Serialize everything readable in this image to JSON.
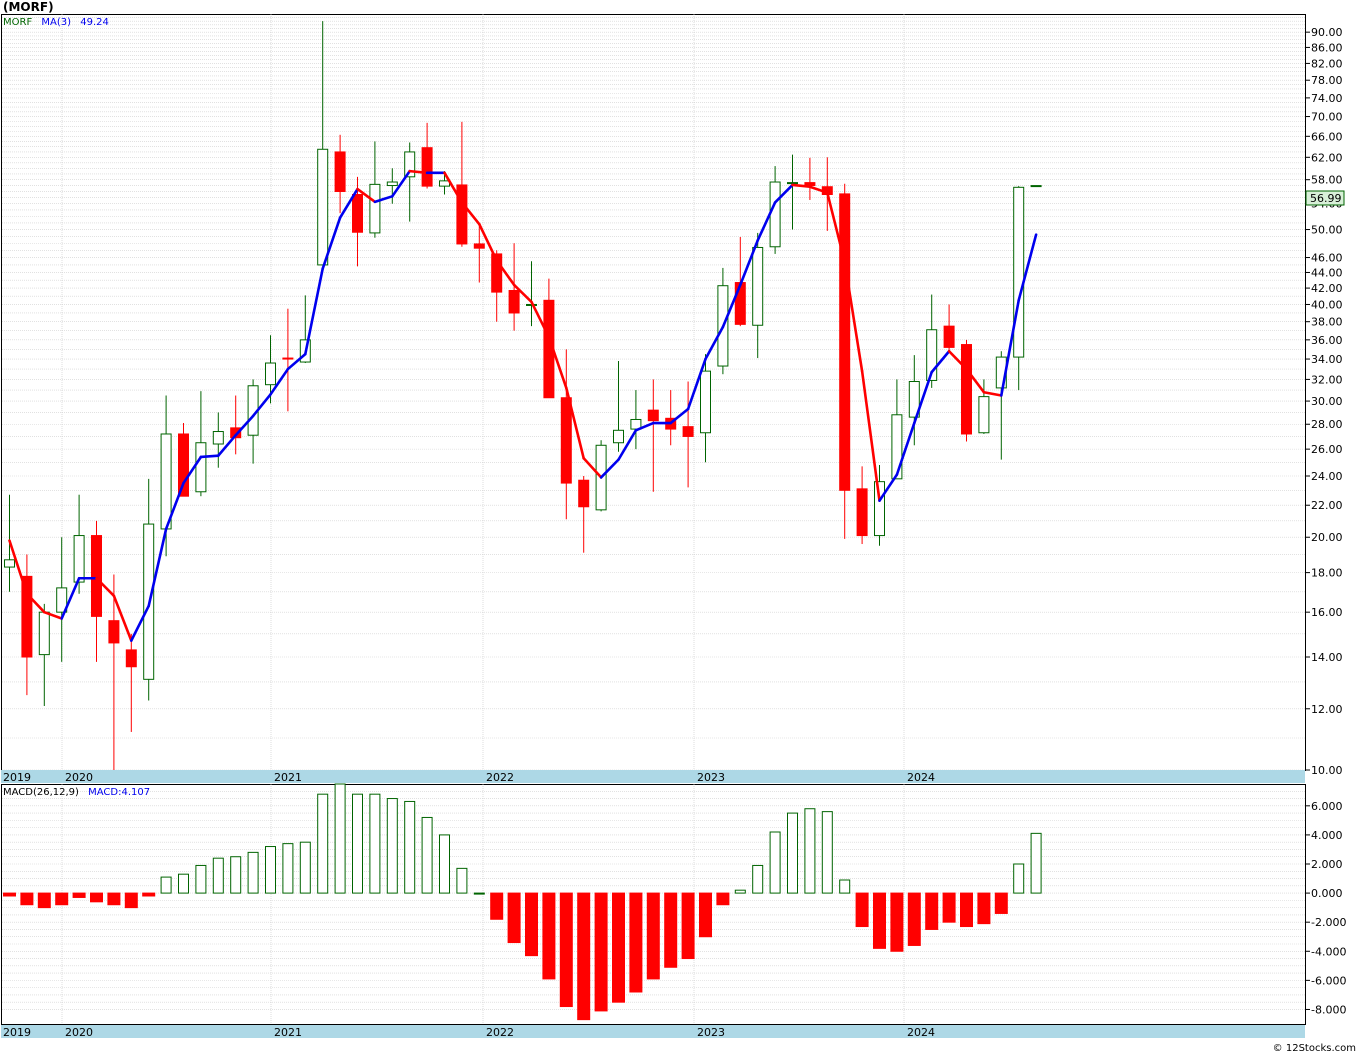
{
  "title": "(MORF)",
  "watermark": "© 12Stocks.com",
  "colors": {
    "up": "#006400",
    "down": "#ff0000",
    "ma_up": "#0000ee",
    "ma_down": "#ff0000",
    "axisband": "#add8e6",
    "price_box": "#d8f0d8"
  },
  "legend_price": {
    "symbol": "MORF",
    "ma_label": "MA(3)",
    "ma_value": "49.24"
  },
  "legend_macd": {
    "label": "MACD(26,12,9)",
    "value_label": "MACD:4.107"
  },
  "current_price_label": "56.99",
  "years": [
    "2019",
    "2020",
    "2021",
    "2022",
    "2023",
    "2024"
  ],
  "chart_data": [
    {
      "type": "candlestick",
      "title": "(MORF)",
      "yscale": "log",
      "ylim": [
        10,
        95
      ],
      "grid": true,
      "yticks": [
        "10.00",
        "12.00",
        "14.00",
        "16.00",
        "18.00",
        "20.00",
        "22.00",
        "24.00",
        "26.00",
        "28.00",
        "30.00",
        "32.00",
        "34.00",
        "36.00",
        "38.00",
        "40.00",
        "42.00",
        "44.00",
        "46.00",
        "50.00",
        "54.00",
        "58.00",
        "62.00",
        "66.00",
        "70.00",
        "74.00",
        "78.00",
        "82.00",
        "86.00",
        "90.00"
      ],
      "x": [
        "2019-07",
        "2019-08",
        "2019-09",
        "2019-10",
        "2019-11",
        "2019-12",
        "2020-01",
        "2020-02",
        "2020-03",
        "2020-04",
        "2020-05",
        "2020-06",
        "2020-07",
        "2020-08",
        "2020-09",
        "2020-10",
        "2020-11",
        "2020-12",
        "2021-01",
        "2021-02",
        "2021-03",
        "2021-04",
        "2021-05",
        "2021-06",
        "2021-07",
        "2021-08",
        "2021-09",
        "2021-10",
        "2021-11",
        "2021-12",
        "2022-01",
        "2022-02",
        "2022-03",
        "2022-04",
        "2022-05",
        "2022-06",
        "2022-07",
        "2022-08",
        "2022-09",
        "2022-10",
        "2022-11",
        "2022-12",
        "2023-01",
        "2023-02",
        "2023-03",
        "2023-04",
        "2023-05",
        "2023-06",
        "2023-07",
        "2023-08",
        "2023-09",
        "2023-10",
        "2023-11",
        "2023-12",
        "2024-01",
        "2024-02",
        "2024-03",
        "2024-04",
        "2024-05",
        "2024-06",
        "2024-07",
        "2024-08"
      ],
      "ohlc": [
        [
          18.3,
          22.7,
          17.0,
          18.7
        ],
        [
          17.8,
          19.0,
          12.5,
          14.0
        ],
        [
          14.1,
          16.4,
          12.1,
          16.0
        ],
        [
          16.0,
          20.0,
          13.8,
          17.2
        ],
        [
          17.5,
          22.7,
          16.9,
          20.1
        ],
        [
          20.1,
          21.0,
          13.8,
          15.8
        ],
        [
          15.6,
          17.9,
          9.9,
          14.6
        ],
        [
          14.3,
          15.0,
          11.2,
          13.6
        ],
        [
          13.1,
          23.8,
          12.3,
          20.8
        ],
        [
          20.5,
          30.5,
          18.9,
          27.2
        ],
        [
          27.2,
          28.1,
          22.6,
          22.6
        ],
        [
          22.9,
          30.9,
          22.6,
          26.5
        ],
        [
          26.4,
          29.0,
          24.6,
          27.4
        ],
        [
          27.7,
          30.5,
          25.6,
          26.9
        ],
        [
          27.1,
          32.0,
          24.9,
          31.4
        ],
        [
          31.5,
          36.5,
          29.8,
          33.6
        ],
        [
          34.1,
          39.5,
          29.1,
          34.0
        ],
        [
          33.7,
          41.1,
          33.6,
          36.0
        ],
        [
          45.0,
          93.0,
          45.0,
          63.5
        ],
        [
          63.0,
          66.3,
          52.5,
          56.0
        ],
        [
          55.5,
          58.5,
          44.8,
          49.6
        ],
        [
          49.5,
          65.0,
          48.8,
          57.2
        ],
        [
          57.0,
          60.0,
          54.0,
          57.6
        ],
        [
          58.5,
          64.8,
          51.2,
          63.0
        ],
        [
          63.8,
          68.7,
          56.5,
          56.9
        ],
        [
          56.9,
          59.5,
          55.5,
          57.8
        ],
        [
          57.1,
          68.9,
          47.5,
          47.9
        ],
        [
          47.9,
          50.5,
          42.7,
          47.3
        ],
        [
          46.5,
          47.0,
          38.0,
          41.5
        ],
        [
          41.7,
          48.0,
          37.0,
          39.0
        ],
        [
          40.0,
          45.5,
          37.5,
          40.0
        ],
        [
          40.5,
          43.2,
          30.3,
          30.3
        ],
        [
          30.3,
          35.0,
          21.1,
          23.5
        ],
        [
          23.7,
          24.0,
          19.1,
          21.9
        ],
        [
          21.7,
          26.7,
          21.6,
          26.3
        ],
        [
          26.5,
          33.8,
          25.8,
          27.5
        ],
        [
          27.6,
          31.0,
          26.0,
          28.4
        ],
        [
          29.2,
          32.0,
          22.9,
          28.3
        ],
        [
          28.5,
          31.0,
          26.3,
          27.6
        ],
        [
          27.8,
          31.8,
          23.2,
          27.0
        ],
        [
          27.3,
          34.5,
          25.0,
          32.8
        ],
        [
          33.3,
          44.6,
          32.5,
          42.3
        ],
        [
          42.7,
          48.9,
          37.5,
          37.7
        ],
        [
          37.6,
          49.5,
          34.1,
          47.4
        ],
        [
          47.5,
          60.4,
          46.5,
          57.6
        ],
        [
          57.5,
          62.5,
          50.0,
          57.5
        ],
        [
          57.5,
          61.9,
          54.6,
          57.0
        ],
        [
          56.8,
          62.0,
          49.8,
          55.5
        ],
        [
          55.6,
          57.3,
          19.9,
          23.0
        ],
        [
          23.1,
          24.7,
          19.6,
          20.1
        ],
        [
          20.1,
          24.8,
          19.5,
          23.6
        ],
        [
          23.8,
          32.0,
          23.8,
          28.8
        ],
        [
          28.6,
          34.4,
          26.3,
          31.8
        ],
        [
          31.9,
          41.2,
          31.2,
          37.1
        ],
        [
          37.5,
          40.0,
          34.8,
          35.2
        ],
        [
          35.5,
          36.0,
          26.6,
          27.2
        ],
        [
          27.3,
          32.0,
          27.2,
          30.4
        ],
        [
          31.2,
          34.8,
          25.2,
          34.2
        ],
        [
          34.2,
          56.9,
          31.0,
          56.7
        ],
        [
          56.99,
          56.99,
          56.99,
          56.99
        ]
      ],
      "ma3": [
        19.8,
        16.9,
        16.0,
        15.7,
        17.7,
        17.7,
        16.8,
        14.7,
        16.3,
        20.5,
        23.5,
        25.4,
        25.5,
        27.1,
        28.7,
        30.6,
        33.0,
        34.5,
        44.5,
        51.8,
        56.4,
        54.3,
        55.2,
        59.5,
        59.2,
        59.2,
        54.2,
        50.8,
        45.6,
        42.4,
        40.3,
        36.3,
        31.2,
        25.3,
        23.9,
        25.2,
        27.5,
        28.1,
        28.1,
        29.3,
        34.0,
        37.4,
        42.4,
        48.4,
        54.2,
        57.1,
        56.8,
        55.8,
        45.4,
        32.8,
        22.3,
        24.1,
        28.1,
        32.7,
        34.8,
        33.0,
        30.8,
        30.5,
        40.5,
        49.24
      ]
    },
    {
      "type": "bar",
      "title": "MACD(26,12,9)",
      "ylim": [
        -9,
        7.5
      ],
      "yticks": [
        "6.000",
        "4.000",
        "2.000",
        "0.000",
        "-2.000",
        "-4.000",
        "-6.000",
        "-8.000"
      ],
      "values": [
        -0.2,
        -0.8,
        -1.0,
        -0.8,
        -0.3,
        -0.6,
        -0.8,
        -1.0,
        -0.2,
        1.1,
        1.3,
        1.9,
        2.4,
        2.5,
        2.8,
        3.2,
        3.4,
        3.5,
        6.8,
        7.5,
        6.8,
        6.8,
        6.5,
        6.3,
        5.2,
        4.0,
        1.7,
        0.0,
        -1.8,
        -3.4,
        -4.3,
        -5.9,
        -7.8,
        -8.7,
        -8.1,
        -7.5,
        -6.8,
        -5.9,
        -5.1,
        -4.5,
        -3.0,
        -0.8,
        0.2,
        1.9,
        4.2,
        5.5,
        5.8,
        5.6,
        0.9,
        -2.3,
        -3.8,
        -4.0,
        -3.6,
        -2.5,
        -2.0,
        -2.3,
        -2.1,
        -1.4,
        2.0,
        4.107
      ]
    }
  ]
}
